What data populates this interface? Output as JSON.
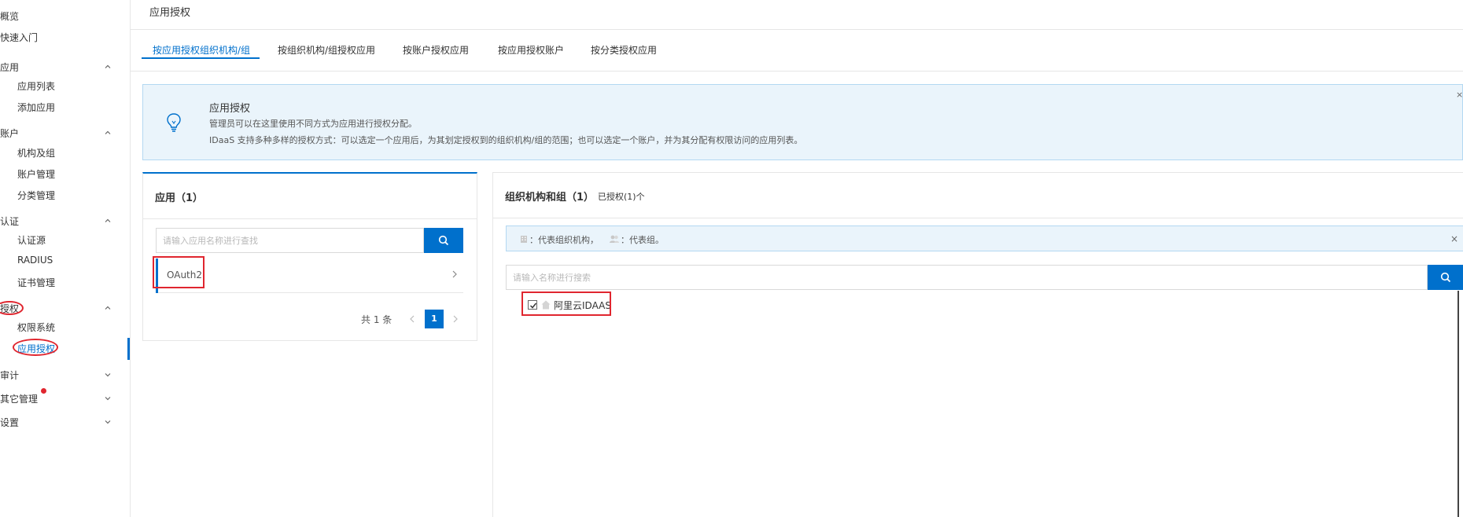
{
  "sidebar": {
    "items": [
      {
        "label": "概览",
        "level": "top"
      },
      {
        "label": "快速入门",
        "level": "top"
      },
      {
        "label": "应用",
        "level": "group",
        "expanded": true
      },
      {
        "label": "应用列表",
        "level": "sub"
      },
      {
        "label": "添加应用",
        "level": "sub"
      },
      {
        "label": "账户",
        "level": "group",
        "expanded": true
      },
      {
        "label": "机构及组",
        "level": "sub"
      },
      {
        "label": "账户管理",
        "level": "sub"
      },
      {
        "label": "分类管理",
        "level": "sub"
      },
      {
        "label": "认证",
        "level": "group",
        "expanded": true
      },
      {
        "label": "认证源",
        "level": "sub"
      },
      {
        "label": "RADIUS",
        "level": "sub"
      },
      {
        "label": "证书管理",
        "level": "sub"
      },
      {
        "label": "授权",
        "level": "group",
        "expanded": true
      },
      {
        "label": "权限系统",
        "level": "sub"
      },
      {
        "label": "应用授权",
        "level": "sub",
        "active": true
      },
      {
        "label": "审计",
        "level": "group",
        "expanded": false
      },
      {
        "label": "其它管理",
        "level": "group",
        "expanded": false,
        "badge": true
      },
      {
        "label": "设置",
        "level": "group",
        "expanded": false
      }
    ]
  },
  "header": {
    "title": "应用授权"
  },
  "tabs": [
    {
      "label": "按应用授权组织机构/组",
      "active": true
    },
    {
      "label": "按组织机构/组授权应用",
      "active": false
    },
    {
      "label": "按账户授权应用",
      "active": false
    },
    {
      "label": "按应用授权账户",
      "active": false
    },
    {
      "label": "按分类授权应用",
      "active": false
    }
  ],
  "notice": {
    "title": "应用授权",
    "line1": "管理员可以在这里使用不同方式为应用进行授权分配。",
    "line2": "IDaaS 支持多种多样的授权方式：可以选定一个应用后，为其划定授权到的组织机构/组的范围；也可以选定一个账户，并为其分配有权限访问的应用列表。",
    "close_glyph": "×",
    "icon": "lightbulb-icon"
  },
  "apps_panel": {
    "title": "应用（1）",
    "search_placeholder": "请输入应用名称进行查找",
    "items": [
      {
        "label": "OAuth2",
        "selected": true
      }
    ],
    "pager": {
      "total": "共 1 条",
      "current": "1"
    }
  },
  "org_panel": {
    "title": "组织机构和组（1）",
    "subtitle": "已授权(1)个",
    "legend": {
      "org_text": "：代表组织机构，",
      "group_text": "：代表组。",
      "close_glyph": "×"
    },
    "search_placeholder": "请输入名称进行搜索",
    "tree": [
      {
        "label": "阿里云IDAAS",
        "checked": true
      }
    ]
  },
  "colors": {
    "accent": "#0070cc",
    "notice_bg": "#eaf4fb",
    "annotation_red": "#e0262f"
  }
}
